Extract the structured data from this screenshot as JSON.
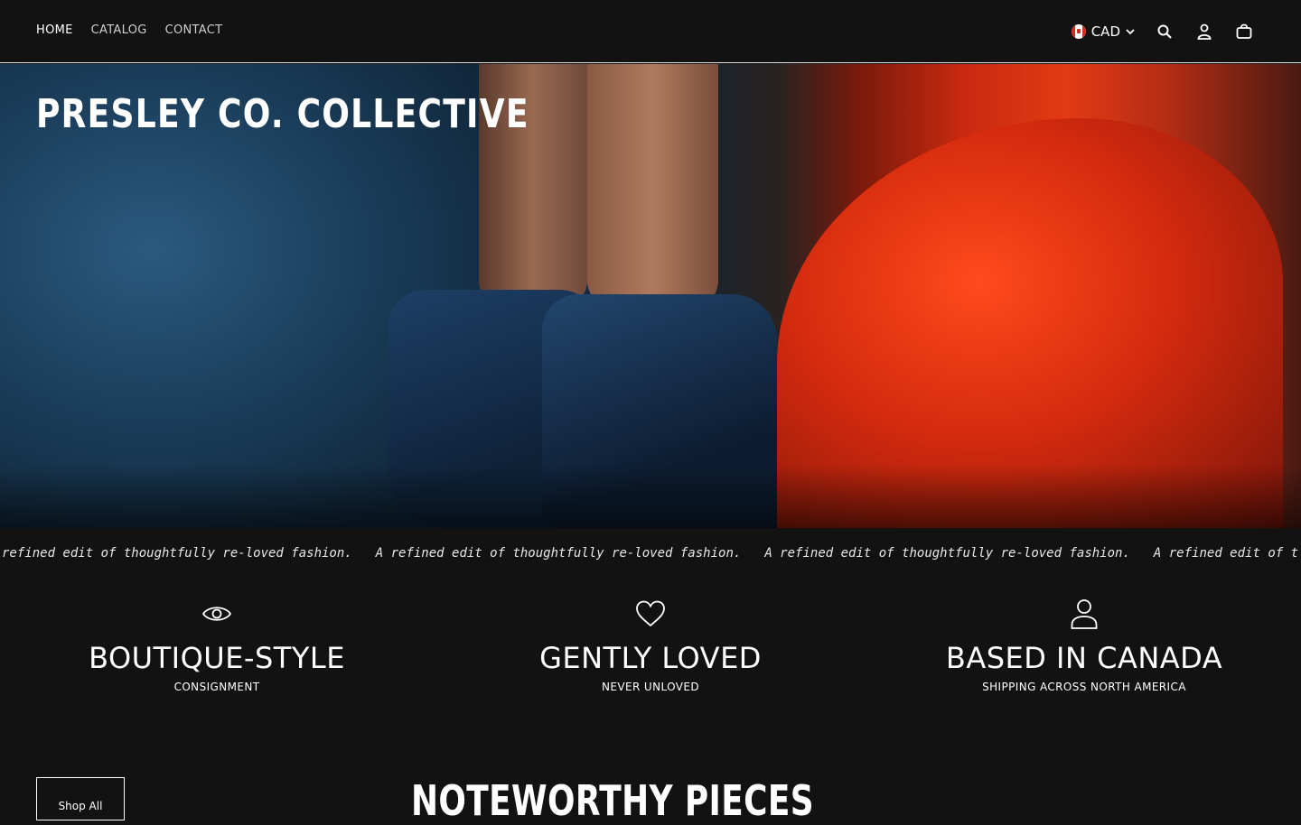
{
  "nav": {
    "home": "HOME",
    "catalog": "CATALOG",
    "contact": "CONTACT"
  },
  "currency": {
    "code": "CAD",
    "flag": "canada-flag-icon"
  },
  "icons": {
    "search": "search-icon",
    "account": "account-icon",
    "cart": "cart-icon"
  },
  "hero": {
    "title": "PRESLEY CO. COLLECTIVE"
  },
  "marquee": {
    "items": [
      "refined edit of thoughtfully re-loved fashion.",
      "A refined edit of thoughtfully re-loved fashion.",
      "A refined edit of thoughtfully re-loved fashion.",
      "A refined edit of t"
    ]
  },
  "features": [
    {
      "icon": "eye-icon",
      "title": "BOUTIQUE-STYLE",
      "subtitle": "CONSIGNMENT"
    },
    {
      "icon": "heart-icon",
      "title": "GENTLY LOVED",
      "subtitle": "NEVER UNLOVED"
    },
    {
      "icon": "person-icon",
      "title": "BASED IN CANADA",
      "subtitle": "SHIPPING ACROSS NORTH AMERICA"
    }
  ],
  "shop_all": "Shop All",
  "section_title": "NOTEWORTHY PIECES",
  "colors": {
    "background": "#121212",
    "text": "#ffffff",
    "accent_red": "#d52b1e"
  }
}
